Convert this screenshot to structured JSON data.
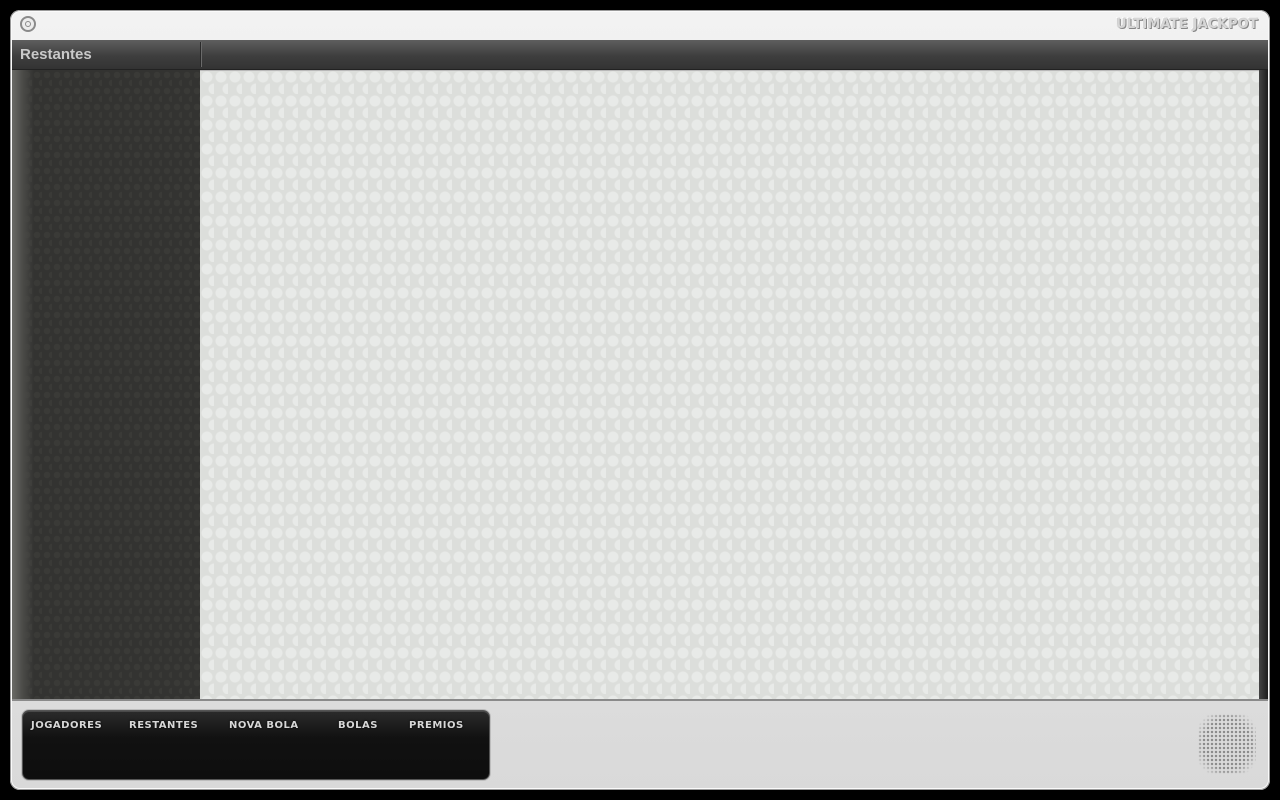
{
  "window": {
    "brand": "ULTIMATE JACKPOT",
    "logo_icon": "target-circle-icon"
  },
  "header": {
    "title": "Restantes"
  },
  "nav": {
    "items": [
      {
        "label": "JOGADORES"
      },
      {
        "label": "RESTANTES"
      },
      {
        "label": "NOVA BOLA"
      },
      {
        "label": "BOLAS"
      },
      {
        "label": "PREMIOS"
      }
    ]
  },
  "decor": {
    "speaker_icon": "speaker-grille-icon"
  },
  "colors": {
    "sidebar_bg": "#333331",
    "content_bg": "#dcdedb",
    "header_bg": "#3e3e3e",
    "frame_bg": "#e6e6e6",
    "nav_bg": "#111111"
  }
}
